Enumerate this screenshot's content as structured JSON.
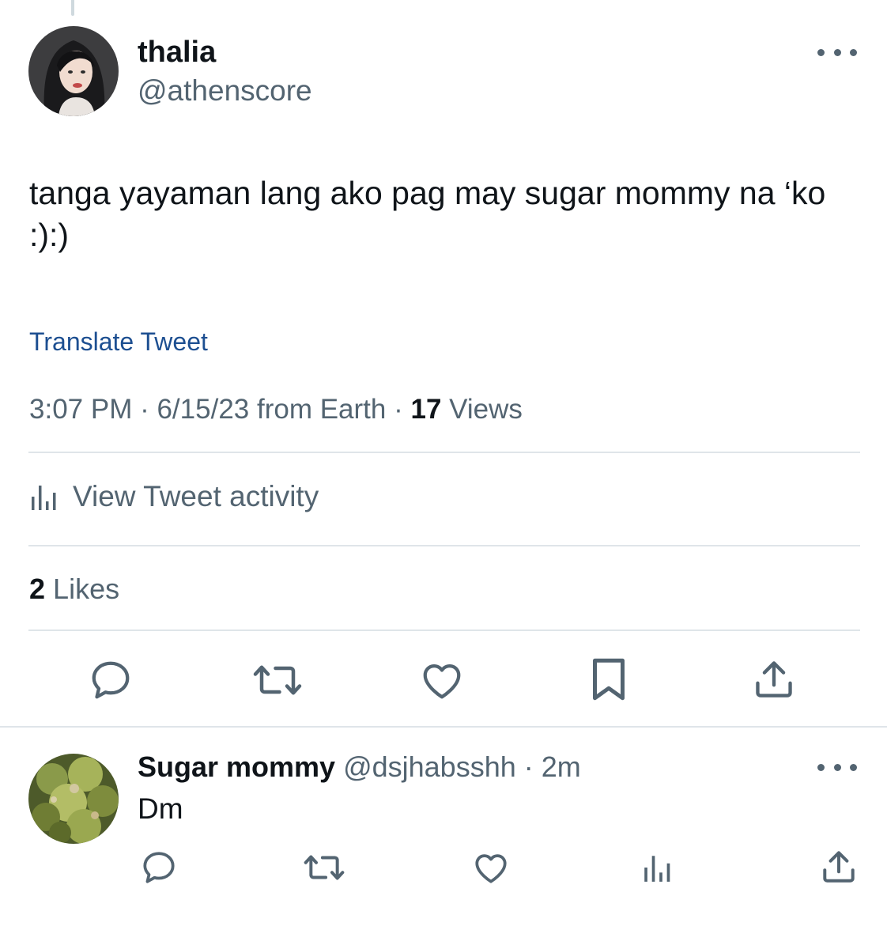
{
  "tweet": {
    "author_name": "thalia",
    "author_handle": "@athenscore",
    "text": "tanga yayaman lang ako pag may sugar mommy na ‘ko :):)",
    "translate_label": "Translate Tweet",
    "time": "3:07 PM",
    "date": "6/15/23",
    "source": "from Earth",
    "views_count": "17",
    "views_label": "Views",
    "activity_label": "View Tweet activity",
    "likes_count": "2",
    "likes_label": "Likes"
  },
  "actions": {
    "icons": [
      "reply-icon",
      "retweet-icon",
      "like-icon",
      "bookmark-icon",
      "share-icon"
    ]
  },
  "reply": {
    "author_name": "Sugar mommy",
    "author_handle": "@dsjhabsshh",
    "age": "2m",
    "text": "Dm",
    "icons": [
      "reply-icon",
      "retweet-icon",
      "like-icon",
      "views-icon",
      "share-icon"
    ]
  },
  "colors": {
    "text_primary": "#0f1419",
    "text_secondary": "#536471",
    "link": "#1d4f91",
    "divider": "#dfe5e9"
  }
}
